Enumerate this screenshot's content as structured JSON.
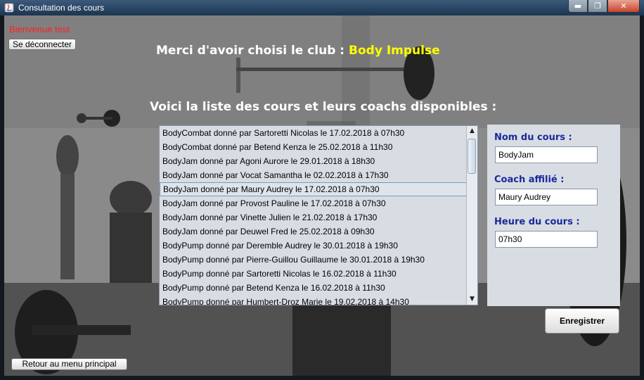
{
  "window": {
    "title": "Consultation des cours",
    "controls": {
      "minimize": "▬",
      "maximize": "❐",
      "close": "✕"
    }
  },
  "header": {
    "welcome": "Bienvenue test",
    "logout_label": "Se déconnecter",
    "club_prefix": "Merci d'avoir choisi le club :",
    "club_name": "Body Impulse",
    "subtitle": "Voici la liste des cours et leurs coachs disponibles :"
  },
  "courses": {
    "selected_index": 4,
    "items": [
      "BodyCombat donné par Sartoretti Nicolas le 17.02.2018 à 07h30",
      "BodyCombat donné par Betend Kenza le 25.02.2018 à 11h30",
      "BodyJam donné par Agoni Aurore le 29.01.2018 à 18h30",
      "BodyJam donné par Vocat Samantha le 02.02.2018 à 17h30",
      "BodyJam donné par Maury Audrey le 17.02.2018 à 07h30",
      "BodyJam donné par Provost Pauline le 17.02.2018 à 07h30",
      "BodyJam donné par Vinette Julien le 21.02.2018 à 17h30",
      "BodyJam donné par Deuwel Fred le 25.02.2018 à 09h30",
      "BodyPump donné par Deremble Audrey le 30.01.2018 à 19h30",
      "BodyPump donné par Pierre-Guillou Guillaume le 30.01.2018 à 19h30",
      "BodyPump donné par Sartoretti Nicolas le 16.02.2018 à 11h30",
      "BodyPump donné par Betend Kenza le 16.02.2018 à 11h30",
      "BodyPump donné par Humbert-Droz Marie le 19.02.2018 à 14h30"
    ]
  },
  "details": {
    "course_label": "Nom du cours :",
    "course_value": "BodyJam",
    "coach_label": "Coach affilié :",
    "coach_value": "Maury Audrey",
    "time_label": "Heure du cours :",
    "time_value": "07h30"
  },
  "actions": {
    "save_label": "Enregistrer",
    "back_label": "Retour au menu principal"
  },
  "colors": {
    "welcome": "#ff2020",
    "club_name": "#ffff00",
    "field_labels": "#1a2a9a"
  }
}
